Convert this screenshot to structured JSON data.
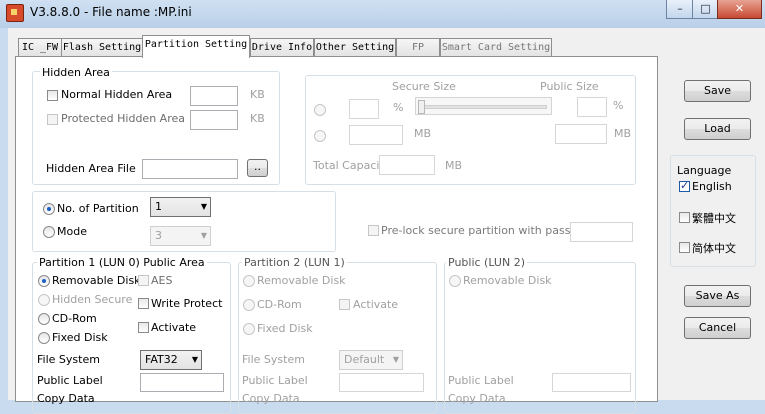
{
  "window": {
    "title": "V3.8.8.0 - File name :MP.ini",
    "minimize": "–",
    "maximize": "□",
    "close": "✕"
  },
  "tabs": [
    {
      "label": "IC _FW"
    },
    {
      "label": "Flash Setting"
    },
    {
      "label": "Partition Setting"
    },
    {
      "label": "Drive Info"
    },
    {
      "label": "Other Setting"
    },
    {
      "label": "FP"
    },
    {
      "label": "Smart Card Setting"
    }
  ],
  "hidden_area": {
    "legend": "Hidden Area",
    "normal_hidden_area": "Normal Hidden Area",
    "protected_hidden_area": "Protected Hidden Area",
    "unit_kb": "KB",
    "hidden_area_file": "Hidden Area File",
    "browse": ".."
  },
  "secure": {
    "secure_size": "Secure Size",
    "public_size": "Public Size",
    "percent": "%",
    "mb": "MB",
    "total_capacity": "Total Capacity",
    "prelock": "Pre-lock secure partition with password :"
  },
  "partition_count": {
    "no_of_partition": "No. of Partition",
    "no_value": "1",
    "mode": "Mode",
    "mode_value": "3"
  },
  "partition1": {
    "legend": "Partition 1 (LUN 0) Public Area",
    "removable": "Removable Disk",
    "hidden_secure": "Hidden Secure",
    "cdrom": "CD-Rom",
    "fixed": "Fixed Disk",
    "aes": "AES",
    "write_protect": "Write Protect",
    "activate": "Activate",
    "file_system": "File System",
    "file_system_value": "FAT32",
    "public_label": "Public Label",
    "copy_data": "Copy Data"
  },
  "partition2": {
    "legend": "Partition 2 (LUN 1)",
    "removable": "Removable Disk",
    "cdrom": "CD-Rom",
    "fixed": "Fixed Disk",
    "activate": "Activate",
    "file_system": "File System",
    "file_system_value": "Default",
    "public_label": "Public Label",
    "copy_data": "Copy Data"
  },
  "public": {
    "legend": "Public (LUN 2)",
    "removable": "Removable Disk",
    "public_label": "Public Label",
    "copy_data": "Copy Data"
  },
  "side": {
    "save": "Save",
    "load": "Load",
    "language": "Language",
    "english": "English",
    "traditional_chinese": "繁體中文",
    "simplified_chinese": "简体中文",
    "save_as": "Save As",
    "cancel": "Cancel"
  }
}
